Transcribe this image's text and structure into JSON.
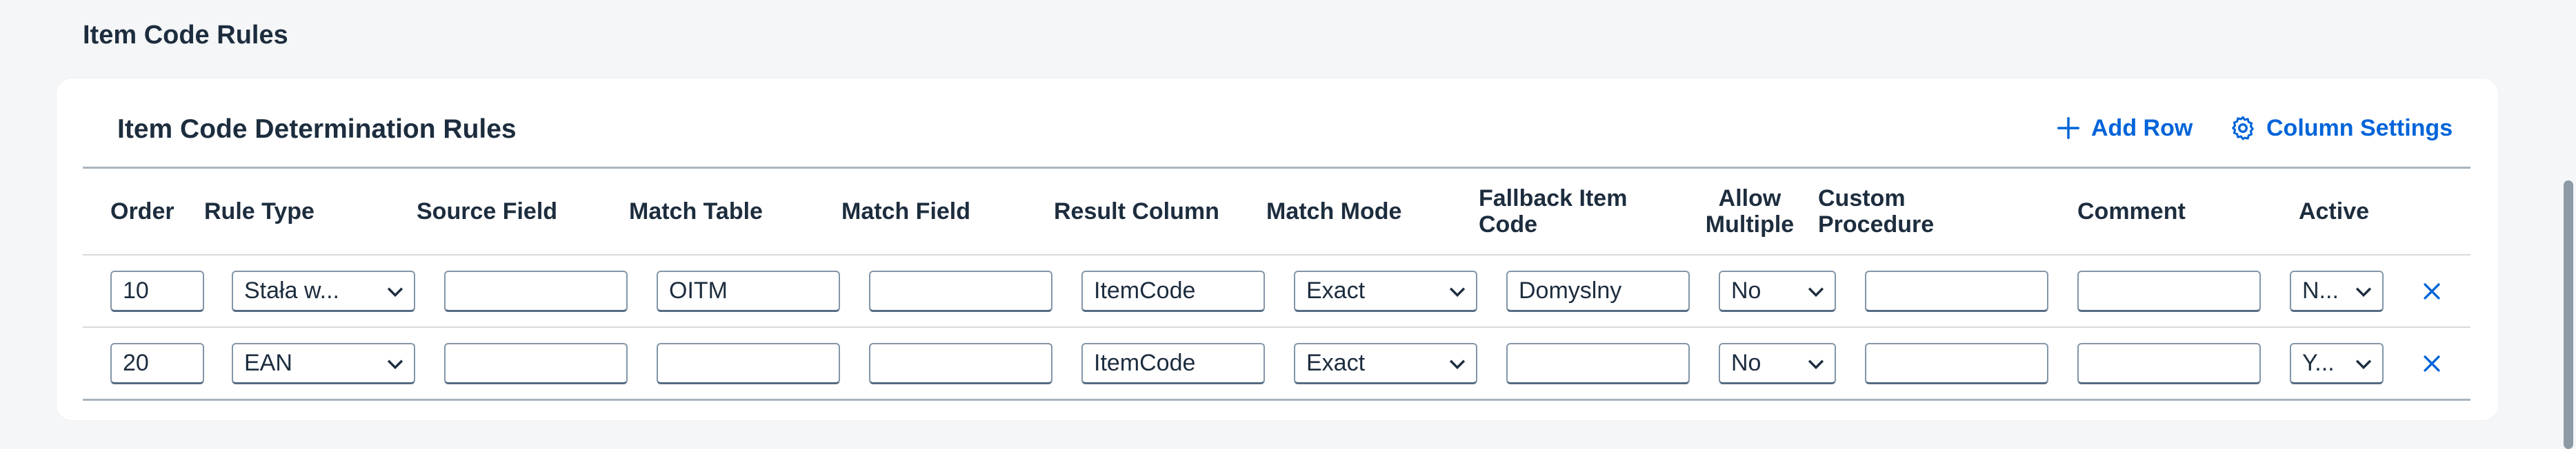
{
  "section": {
    "title": "Item Code Rules"
  },
  "card": {
    "title": "Item Code Determination Rules",
    "add_row_label": "Add Row",
    "column_settings_label": "Column Settings"
  },
  "columns": {
    "order": "Order",
    "rule_type": "Rule Type",
    "source_field": "Source Field",
    "match_table": "Match Table",
    "match_field": "Match Field",
    "result_column": "Result Column",
    "match_mode": "Match Mode",
    "fallback_item_code": "Fallback Item Code",
    "allow_multiple": "Allow Multiple",
    "custom_procedure": "Custom Procedure",
    "comment": "Comment",
    "active": "Active"
  },
  "rows": [
    {
      "order": "10",
      "rule_type": "Stała w...",
      "source_field": "",
      "match_table": "OITM",
      "match_field": "",
      "result_column": "ItemCode",
      "match_mode": "Exact",
      "fallback_item_code": "Domyslny",
      "allow_multiple": "No",
      "custom_procedure": "",
      "comment": "",
      "active": "N..."
    },
    {
      "order": "20",
      "rule_type": "EAN",
      "source_field": "",
      "match_table": "",
      "match_field": "",
      "result_column": "ItemCode",
      "match_mode": "Exact",
      "fallback_item_code": "",
      "allow_multiple": "No",
      "custom_procedure": "",
      "comment": "",
      "active": "Y..."
    }
  ],
  "icons": {
    "add": "plus-icon",
    "settings": "gear-icon",
    "dropdown": "chevron-down-icon",
    "delete": "close-icon"
  },
  "colors": {
    "accent": "#0064d9",
    "background": "#f5f6f7",
    "card": "#ffffff",
    "text": "#1d2d3e"
  }
}
